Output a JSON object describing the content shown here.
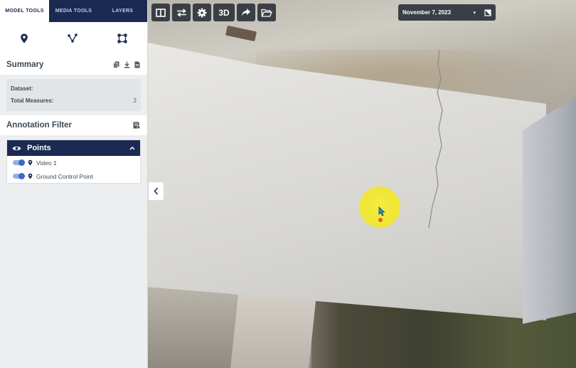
{
  "tabs": [
    {
      "label": "MODEL TOOLS",
      "active": true
    },
    {
      "label": "MEDIA TOOLS",
      "active": false
    },
    {
      "label": "LAYERS",
      "active": false
    }
  ],
  "tool_icons": [
    "map-pin-icon",
    "polyline-icon",
    "polygon-icon"
  ],
  "summary": {
    "title": "Summary",
    "icons": [
      "copy-icon",
      "download-icon",
      "document-icon"
    ],
    "rows": [
      {
        "label": "Dataset:",
        "value": ""
      },
      {
        "label": "Total Measures:",
        "value": "2"
      }
    ]
  },
  "annotation_filter": {
    "title": "Annotation Filter",
    "icon": "filter-list-icon"
  },
  "points": {
    "title": "Points",
    "items": [
      {
        "label": "Video 1",
        "enabled": true
      },
      {
        "label": "Ground Control Point",
        "enabled": true
      }
    ]
  },
  "toolbar": {
    "buttons": [
      "split-view-icon",
      "swap-icon",
      "gear-icon",
      "3D",
      "share-arrow-icon",
      "folder-open-icon"
    ],
    "three_d_label": "3D"
  },
  "date_selector": {
    "value": "November 7, 2023",
    "compare_icon": "compare-icon"
  },
  "colors": {
    "navy": "#1b2a52",
    "highlight": "#f4ee40",
    "toggle": "#3b68c9"
  }
}
